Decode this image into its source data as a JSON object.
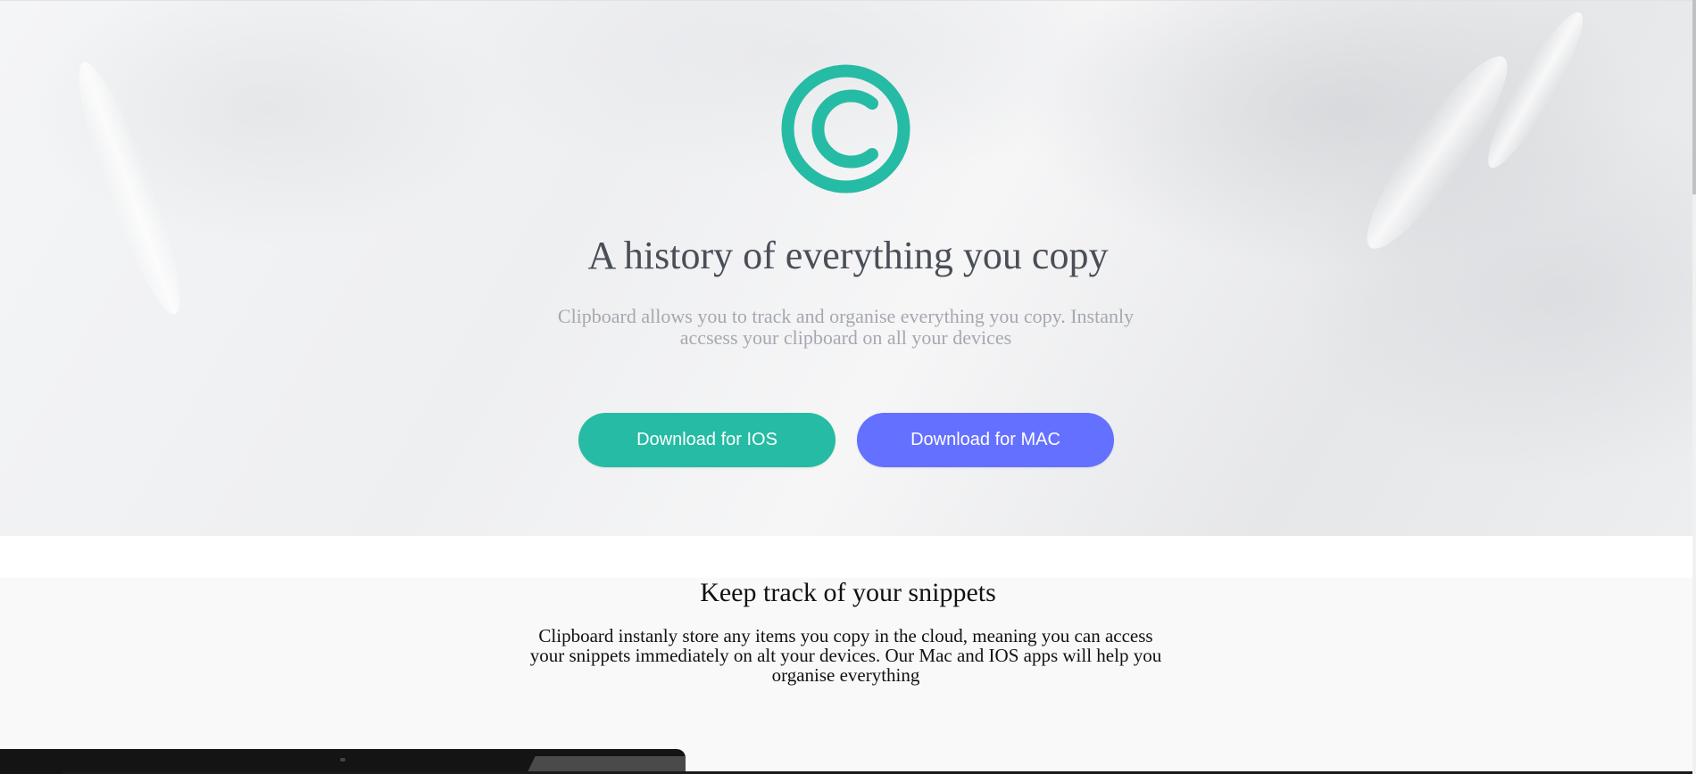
{
  "hero": {
    "logo_icon": "copyright-c-icon",
    "title": "A history of everything you copy",
    "subtitle": "Clipboard allows you to track and organise everything you copy. Instanly accsess your clipboard on all your devices",
    "buttons": {
      "ios_label": "Download for IOS",
      "mac_label": "Download for MAC"
    }
  },
  "snippets": {
    "title": "Keep track of your snippets",
    "text": "Clipboard instanly store any items you copy in the cloud, meaning you can access your snippets immediately on alt your devices. Our Mac and IOS apps will help you organise everything"
  },
  "colors": {
    "accent_green": "#26bba4",
    "accent_blue": "#6470ff",
    "title_text": "#4a4e57",
    "subtitle_text": "#a5a8b0"
  }
}
